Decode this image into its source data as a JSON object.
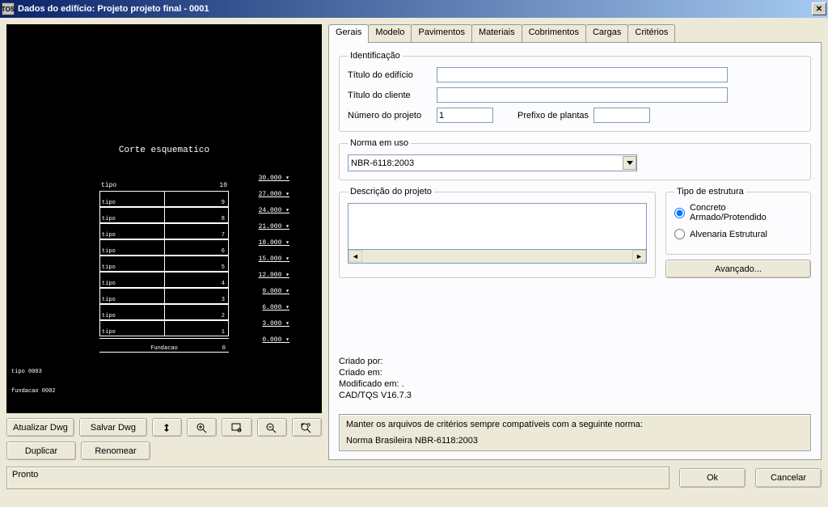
{
  "titlebar": {
    "title": "Dados do edifício: Projeto projeto final - 0001",
    "icon_name": "TOS"
  },
  "cad": {
    "title": "Corte esquematico",
    "header_left": "tipo",
    "header_right": "10",
    "floors": [
      {
        "label": "tipo",
        "num": "9"
      },
      {
        "label": "tipo",
        "num": "8"
      },
      {
        "label": "tipo",
        "num": "7"
      },
      {
        "label": "tipo",
        "num": "6"
      },
      {
        "label": "tipo",
        "num": "5"
      },
      {
        "label": "tipo",
        "num": "4"
      },
      {
        "label": "tipo",
        "num": "3"
      },
      {
        "label": "tipo",
        "num": "2"
      },
      {
        "label": "tipo",
        "num": "1"
      },
      {
        "label": "Fundacao",
        "num": "0"
      }
    ],
    "elevations": [
      "30.000",
      "27.000",
      "24.000",
      "21.000",
      "18.000",
      "15.000",
      "12.000",
      "9.000",
      "6.000",
      "3.000",
      "0.000"
    ],
    "side_labels": {
      "tipo": "tipo     0003",
      "fundacao": "fundacao 0002"
    }
  },
  "left_buttons": {
    "atualizar": "Atualizar Dwg",
    "salvar": "Salvar Dwg",
    "duplicar": "Duplicar",
    "renomear": "Renomear"
  },
  "tabs": [
    "Gerais",
    "Modelo",
    "Pavimentos",
    "Materiais",
    "Cobrimentos",
    "Cargas",
    "Critérios"
  ],
  "ident": {
    "legend": "Identificação",
    "titulo_edificio": {
      "label": "Título do edifício",
      "value": ""
    },
    "titulo_cliente": {
      "label": "Título do cliente",
      "value": ""
    },
    "numero_projeto": {
      "label": "Número do projeto",
      "value": "1"
    },
    "prefixo": {
      "label": "Prefixo de plantas",
      "value": ""
    }
  },
  "norma": {
    "legend": "Norma em uso",
    "value": "NBR-6118:2003"
  },
  "descricao": {
    "legend": "Descrição do projeto",
    "value": ""
  },
  "tipo_estrutura": {
    "legend": "Tipo de estrutura",
    "opt1": "Concreto Armado/Protendido",
    "opt2": "Alvenaria Estrutural",
    "selected": "opt1",
    "avancado": "Avançado..."
  },
  "meta": {
    "criado_por": "Criado por:",
    "criado_em": "Criado em:",
    "modificado_em": "Modificado em: .",
    "cad_tos": "CAD/TQS        V16.7.3"
  },
  "compat": {
    "line1": "Manter os arquivos de critérios sempre compatíveis com a seguinte norma:",
    "line2": "Norma Brasileira NBR-6118:2003"
  },
  "status": "Pronto",
  "actions": {
    "ok": "Ok",
    "cancelar": "Cancelar"
  }
}
